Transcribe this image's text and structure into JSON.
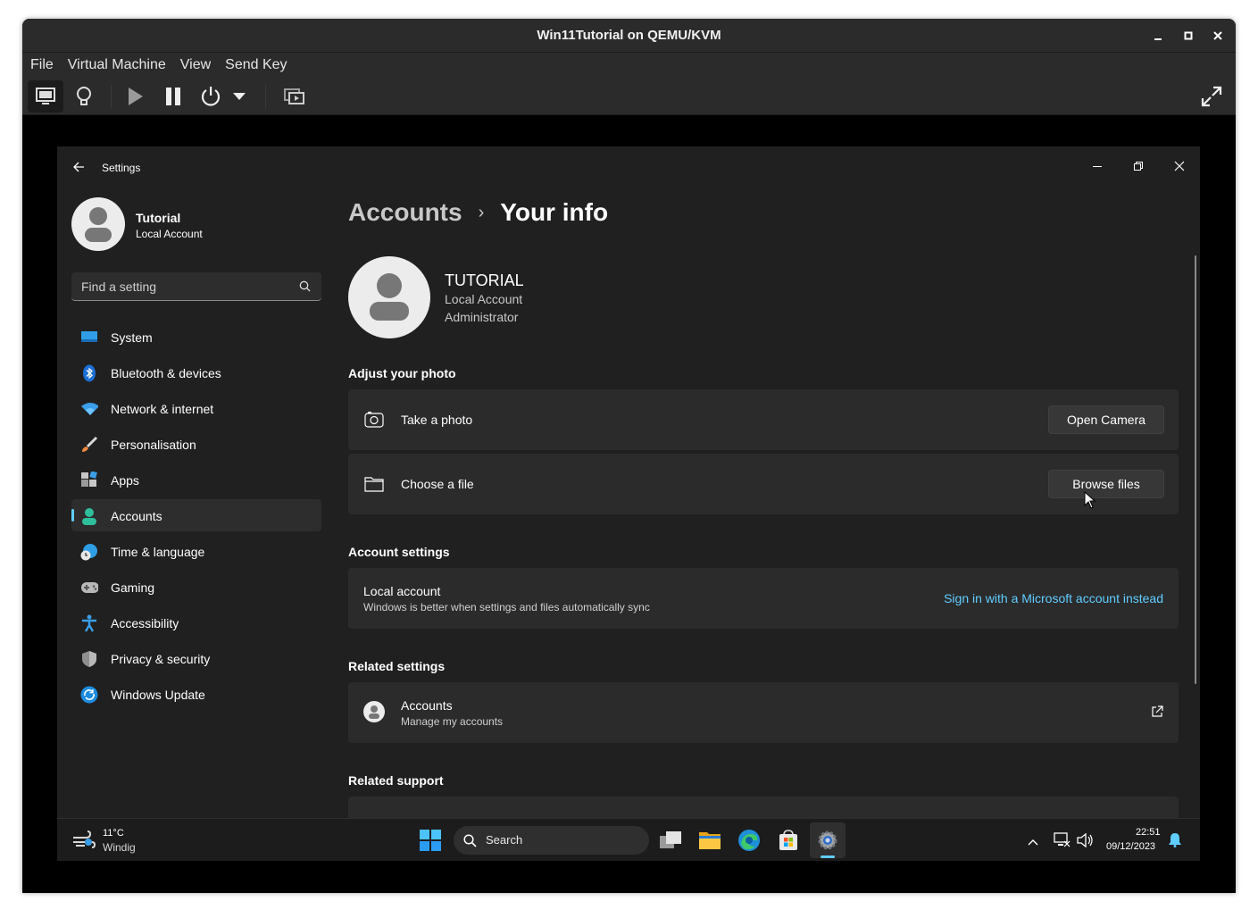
{
  "host": {
    "title": "Win11Tutorial on QEMU/KVM",
    "menu": [
      "File",
      "Virtual Machine",
      "View",
      "Send Key"
    ]
  },
  "guest": {
    "window_title": "Settings",
    "profile": {
      "name": "Tutorial",
      "type": "Local Account"
    },
    "search_placeholder": "Find a setting",
    "nav": [
      {
        "label": "System",
        "icon": "monitor-icon"
      },
      {
        "label": "Bluetooth & devices",
        "icon": "bluetooth-icon"
      },
      {
        "label": "Network & internet",
        "icon": "wifi-icon"
      },
      {
        "label": "Personalisation",
        "icon": "brush-icon"
      },
      {
        "label": "Apps",
        "icon": "apps-icon"
      },
      {
        "label": "Accounts",
        "icon": "person-icon",
        "selected": true
      },
      {
        "label": "Time & language",
        "icon": "globe-clock-icon"
      },
      {
        "label": "Gaming",
        "icon": "gamepad-icon"
      },
      {
        "label": "Accessibility",
        "icon": "accessibility-icon"
      },
      {
        "label": "Privacy & security",
        "icon": "shield-icon"
      },
      {
        "label": "Windows Update",
        "icon": "update-icon"
      }
    ],
    "breadcrumb": {
      "parent": "Accounts",
      "separator": "›",
      "current": "Your info"
    },
    "user": {
      "name": "TUTORIAL",
      "account": "Local Account",
      "role": "Administrator"
    },
    "photo": {
      "heading": "Adjust your photo",
      "take_label": "Take a photo",
      "take_button": "Open Camera",
      "choose_label": "Choose a file",
      "choose_button": "Browse files"
    },
    "account_settings": {
      "heading": "Account settings",
      "title": "Local account",
      "desc": "Windows is better when settings and files automatically sync",
      "link": "Sign in with a Microsoft account instead"
    },
    "related": {
      "heading": "Related settings",
      "title": "Accounts",
      "desc": "Manage my accounts"
    },
    "support": {
      "heading": "Related support"
    },
    "taskbar": {
      "weather_temp": "11°C",
      "weather_desc": "Windig",
      "search": "Search",
      "time": "22:51",
      "date": "09/12/2023"
    },
    "accent_color": "#60cdff"
  }
}
